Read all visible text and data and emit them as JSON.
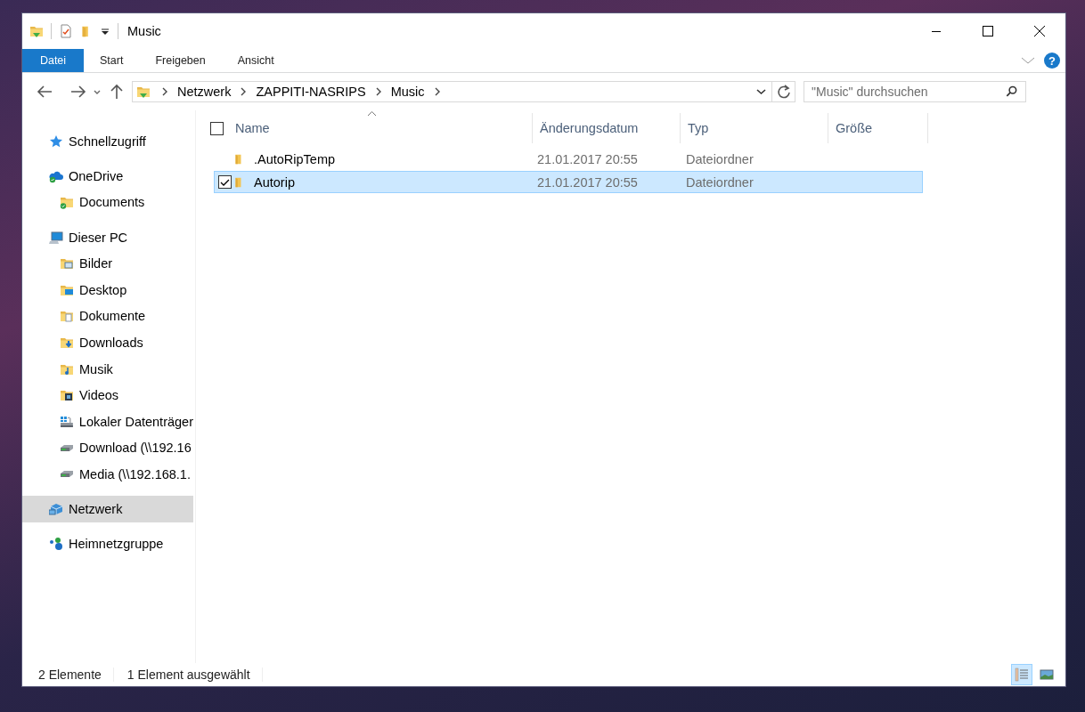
{
  "window": {
    "title": "Music"
  },
  "ribbon": {
    "tabs": [
      {
        "label": "Datei",
        "kind": "file"
      },
      {
        "label": "Start",
        "kind": "tab"
      },
      {
        "label": "Freigeben",
        "kind": "tab"
      },
      {
        "label": "Ansicht",
        "kind": "tab"
      }
    ],
    "help": "?"
  },
  "address": {
    "path": [
      "Netzwerk",
      "ZAPPITI-NASRIPS",
      "Music"
    ]
  },
  "search": {
    "placeholder": "\"Music\" durchsuchen"
  },
  "sidebar": {
    "items": [
      {
        "label": "Schnellzugriff",
        "kind": "quick",
        "selected": false
      },
      {
        "label": "OneDrive",
        "kind": "cloud",
        "selected": false,
        "children": [
          {
            "label": "Documents",
            "kind": "syncfolder",
            "selected": false
          }
        ]
      },
      {
        "label": "Dieser PC",
        "kind": "pc",
        "selected": false,
        "children": [
          {
            "label": "Bilder",
            "kind": "pictures",
            "selected": false
          },
          {
            "label": "Desktop",
            "kind": "desktop",
            "selected": false
          },
          {
            "label": "Dokumente",
            "kind": "documents",
            "selected": false
          },
          {
            "label": "Downloads",
            "kind": "downloads",
            "selected": false
          },
          {
            "label": "Musik",
            "kind": "music",
            "selected": false
          },
          {
            "label": "Videos",
            "kind": "videos",
            "selected": false
          },
          {
            "label": "Lokaler Datenträger",
            "kind": "localdrive",
            "selected": false
          },
          {
            "label": "Download (\\\\192.16",
            "kind": "netdrive",
            "selected": false
          },
          {
            "label": "Media (\\\\192.168.1.",
            "kind": "netdrive",
            "selected": false
          }
        ]
      },
      {
        "label": "Netzwerk",
        "kind": "network",
        "selected": true
      },
      {
        "label": "Heimnetzgruppe",
        "kind": "homegroup",
        "selected": false
      }
    ]
  },
  "file_list": {
    "header_checkbox": {
      "checked": false
    },
    "columns": [
      {
        "label": "Name",
        "sorted": true
      },
      {
        "label": "Änderungsdatum",
        "sorted": false
      },
      {
        "label": "Typ",
        "sorted": false
      },
      {
        "label": "Größe",
        "sorted": false
      }
    ],
    "rows": [
      {
        "name": ".AutoRipTemp",
        "modified": "21.01.2017 20:55",
        "type": "Dateiordner",
        "selected": false
      },
      {
        "name": "Autorip",
        "modified": "21.01.2017 20:55",
        "type": "Dateiordner",
        "selected": true
      }
    ]
  },
  "status_bar": {
    "item_count": "2 Elemente",
    "selection": "1 Element ausgewählt",
    "views": [
      {
        "kind": "details",
        "selected": true
      },
      {
        "kind": "tiles",
        "selected": false
      }
    ]
  }
}
